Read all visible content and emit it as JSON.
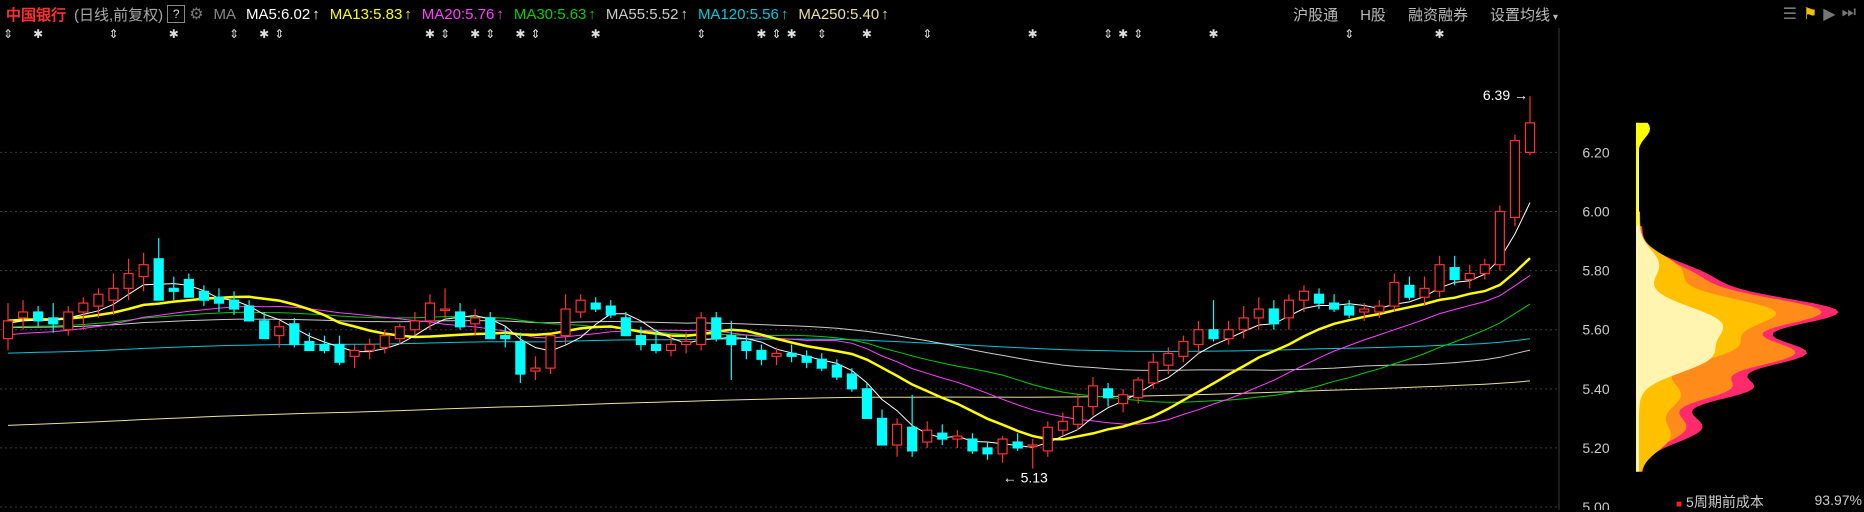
{
  "header": {
    "stock_name": "中国银行",
    "period": "(日线,前复权)",
    "help": "?",
    "ma_label": "MA",
    "ma_items": [
      {
        "label": "MA5:6.02",
        "color": "#ffffff",
        "arrow": "↑"
      },
      {
        "label": "MA13:5.83",
        "color": "#ffff00",
        "arrow": "↑"
      },
      {
        "label": "MA20:5.76",
        "color": "#ff40ff",
        "arrow": "↑"
      },
      {
        "label": "MA30:5.63",
        "color": "#00d000",
        "arrow": "↑"
      },
      {
        "label": "MA55:5.52",
        "color": "#cccccc",
        "arrow": "↑"
      },
      {
        "label": "MA120:5.56",
        "color": "#00c8d8",
        "arrow": "↑"
      },
      {
        "label": "MA250:5.40",
        "color": "#e8e0a0",
        "arrow": "↑"
      }
    ],
    "links": [
      "沪股通",
      "H股",
      "融资融券",
      "设置均线"
    ]
  },
  "colors": {
    "up": "#ff3030",
    "down": "#00ffff",
    "grid": "#3a3a3a",
    "axis_text": "#cccccc"
  },
  "chart_data": {
    "type": "candlestick",
    "y_ticks": [
      "6.20",
      "6.00",
      "5.80",
      "5.60",
      "5.40",
      "5.20",
      "5.00"
    ],
    "ylim": [
      4.99,
      6.56
    ],
    "annotations": {
      "high": "6.39 →",
      "low": "← 5.13"
    },
    "candles": [
      {
        "o": 5.57,
        "h": 5.69,
        "l": 5.53,
        "c": 5.63
      },
      {
        "o": 5.64,
        "h": 5.7,
        "l": 5.6,
        "c": 5.66
      },
      {
        "o": 5.66,
        "h": 5.68,
        "l": 5.61,
        "c": 5.63
      },
      {
        "o": 5.64,
        "h": 5.69,
        "l": 5.59,
        "c": 5.62
      },
      {
        "o": 5.6,
        "h": 5.68,
        "l": 5.58,
        "c": 5.66
      },
      {
        "o": 5.66,
        "h": 5.71,
        "l": 5.6,
        "c": 5.69
      },
      {
        "o": 5.68,
        "h": 5.74,
        "l": 5.64,
        "c": 5.72
      },
      {
        "o": 5.7,
        "h": 5.79,
        "l": 5.65,
        "c": 5.74
      },
      {
        "o": 5.74,
        "h": 5.84,
        "l": 5.7,
        "c": 5.79
      },
      {
        "o": 5.78,
        "h": 5.86,
        "l": 5.73,
        "c": 5.82
      },
      {
        "o": 5.84,
        "h": 5.91,
        "l": 5.7,
        "c": 5.7
      },
      {
        "o": 5.74,
        "h": 5.78,
        "l": 5.7,
        "c": 5.73
      },
      {
        "o": 5.77,
        "h": 5.79,
        "l": 5.71,
        "c": 5.71
      },
      {
        "o": 5.73,
        "h": 5.75,
        "l": 5.68,
        "c": 5.7
      },
      {
        "o": 5.71,
        "h": 5.74,
        "l": 5.66,
        "c": 5.69
      },
      {
        "o": 5.7,
        "h": 5.73,
        "l": 5.65,
        "c": 5.67
      },
      {
        "o": 5.68,
        "h": 5.7,
        "l": 5.64,
        "c": 5.63
      },
      {
        "o": 5.63,
        "h": 5.66,
        "l": 5.57,
        "c": 5.57
      },
      {
        "o": 5.58,
        "h": 5.63,
        "l": 5.54,
        "c": 5.61
      },
      {
        "o": 5.62,
        "h": 5.64,
        "l": 5.54,
        "c": 5.55
      },
      {
        "o": 5.56,
        "h": 5.59,
        "l": 5.53,
        "c": 5.53
      },
      {
        "o": 5.55,
        "h": 5.58,
        "l": 5.52,
        "c": 5.53
      },
      {
        "o": 5.55,
        "h": 5.58,
        "l": 5.48,
        "c": 5.49
      },
      {
        "o": 5.51,
        "h": 5.55,
        "l": 5.47,
        "c": 5.53
      },
      {
        "o": 5.53,
        "h": 5.57,
        "l": 5.5,
        "c": 5.55
      },
      {
        "o": 5.54,
        "h": 5.6,
        "l": 5.52,
        "c": 5.58
      },
      {
        "o": 5.57,
        "h": 5.62,
        "l": 5.55,
        "c": 5.61
      },
      {
        "o": 5.6,
        "h": 5.66,
        "l": 5.58,
        "c": 5.63
      },
      {
        "o": 5.63,
        "h": 5.72,
        "l": 5.6,
        "c": 5.69
      },
      {
        "o": 5.67,
        "h": 5.74,
        "l": 5.64,
        "c": 5.67
      },
      {
        "o": 5.66,
        "h": 5.69,
        "l": 5.6,
        "c": 5.61
      },
      {
        "o": 5.62,
        "h": 5.67,
        "l": 5.58,
        "c": 5.64
      },
      {
        "o": 5.64,
        "h": 5.66,
        "l": 5.57,
        "c": 5.57
      },
      {
        "o": 5.58,
        "h": 5.61,
        "l": 5.54,
        "c": 5.57
      },
      {
        "o": 5.56,
        "h": 5.59,
        "l": 5.42,
        "c": 5.45
      },
      {
        "o": 5.46,
        "h": 5.51,
        "l": 5.43,
        "c": 5.47
      },
      {
        "o": 5.47,
        "h": 5.58,
        "l": 5.45,
        "c": 5.58
      },
      {
        "o": 5.58,
        "h": 5.72,
        "l": 5.55,
        "c": 5.67
      },
      {
        "o": 5.66,
        "h": 5.72,
        "l": 5.64,
        "c": 5.7
      },
      {
        "o": 5.69,
        "h": 5.71,
        "l": 5.66,
        "c": 5.67
      },
      {
        "o": 5.68,
        "h": 5.7,
        "l": 5.64,
        "c": 5.65
      },
      {
        "o": 5.64,
        "h": 5.66,
        "l": 5.58,
        "c": 5.58
      },
      {
        "o": 5.58,
        "h": 5.61,
        "l": 5.53,
        "c": 5.55
      },
      {
        "o": 5.55,
        "h": 5.6,
        "l": 5.52,
        "c": 5.53
      },
      {
        "o": 5.53,
        "h": 5.58,
        "l": 5.51,
        "c": 5.55
      },
      {
        "o": 5.55,
        "h": 5.59,
        "l": 5.52,
        "c": 5.56
      },
      {
        "o": 5.55,
        "h": 5.66,
        "l": 5.53,
        "c": 5.64
      },
      {
        "o": 5.64,
        "h": 5.66,
        "l": 5.56,
        "c": 5.57
      },
      {
        "o": 5.58,
        "h": 5.63,
        "l": 5.43,
        "c": 5.55
      },
      {
        "o": 5.56,
        "h": 5.58,
        "l": 5.5,
        "c": 5.53
      },
      {
        "o": 5.53,
        "h": 5.55,
        "l": 5.48,
        "c": 5.5
      },
      {
        "o": 5.51,
        "h": 5.54,
        "l": 5.48,
        "c": 5.52
      },
      {
        "o": 5.52,
        "h": 5.55,
        "l": 5.49,
        "c": 5.51
      },
      {
        "o": 5.51,
        "h": 5.53,
        "l": 5.47,
        "c": 5.49
      },
      {
        "o": 5.5,
        "h": 5.52,
        "l": 5.46,
        "c": 5.47
      },
      {
        "o": 5.48,
        "h": 5.5,
        "l": 5.43,
        "c": 5.44
      },
      {
        "o": 5.45,
        "h": 5.47,
        "l": 5.39,
        "c": 5.4
      },
      {
        "o": 5.4,
        "h": 5.42,
        "l": 5.3,
        "c": 5.3
      },
      {
        "o": 5.3,
        "h": 5.33,
        "l": 5.21,
        "c": 5.21
      },
      {
        "o": 5.21,
        "h": 5.3,
        "l": 5.17,
        "c": 5.28
      },
      {
        "o": 5.27,
        "h": 5.38,
        "l": 5.17,
        "c": 5.19
      },
      {
        "o": 5.22,
        "h": 5.29,
        "l": 5.2,
        "c": 5.26
      },
      {
        "o": 5.25,
        "h": 5.28,
        "l": 5.21,
        "c": 5.23
      },
      {
        "o": 5.23,
        "h": 5.26,
        "l": 5.2,
        "c": 5.24
      },
      {
        "o": 5.23,
        "h": 5.25,
        "l": 5.18,
        "c": 5.19
      },
      {
        "o": 5.2,
        "h": 5.22,
        "l": 5.16,
        "c": 5.18
      },
      {
        "o": 5.18,
        "h": 5.24,
        "l": 5.15,
        "c": 5.23
      },
      {
        "o": 5.22,
        "h": 5.25,
        "l": 5.19,
        "c": 5.2
      },
      {
        "o": 5.21,
        "h": 5.23,
        "l": 5.13,
        "c": 5.21
      },
      {
        "o": 5.19,
        "h": 5.29,
        "l": 5.17,
        "c": 5.27
      },
      {
        "o": 5.26,
        "h": 5.32,
        "l": 5.24,
        "c": 5.29
      },
      {
        "o": 5.28,
        "h": 5.38,
        "l": 5.26,
        "c": 5.34
      },
      {
        "o": 5.34,
        "h": 5.44,
        "l": 5.31,
        "c": 5.41
      },
      {
        "o": 5.4,
        "h": 5.42,
        "l": 5.34,
        "c": 5.37
      },
      {
        "o": 5.35,
        "h": 5.4,
        "l": 5.32,
        "c": 5.38
      },
      {
        "o": 5.37,
        "h": 5.44,
        "l": 5.35,
        "c": 5.43
      },
      {
        "o": 5.42,
        "h": 5.52,
        "l": 5.4,
        "c": 5.49
      },
      {
        "o": 5.48,
        "h": 5.54,
        "l": 5.45,
        "c": 5.52
      },
      {
        "o": 5.51,
        "h": 5.58,
        "l": 5.49,
        "c": 5.56
      },
      {
        "o": 5.55,
        "h": 5.63,
        "l": 5.52,
        "c": 5.6
      },
      {
        "o": 5.6,
        "h": 5.7,
        "l": 5.56,
        "c": 5.57
      },
      {
        "o": 5.57,
        "h": 5.63,
        "l": 5.55,
        "c": 5.6
      },
      {
        "o": 5.6,
        "h": 5.68,
        "l": 5.57,
        "c": 5.64
      },
      {
        "o": 5.64,
        "h": 5.71,
        "l": 5.6,
        "c": 5.67
      },
      {
        "o": 5.67,
        "h": 5.7,
        "l": 5.6,
        "c": 5.62
      },
      {
        "o": 5.64,
        "h": 5.72,
        "l": 5.6,
        "c": 5.7
      },
      {
        "o": 5.7,
        "h": 5.75,
        "l": 5.66,
        "c": 5.73
      },
      {
        "o": 5.72,
        "h": 5.74,
        "l": 5.67,
        "c": 5.69
      },
      {
        "o": 5.69,
        "h": 5.72,
        "l": 5.66,
        "c": 5.67
      },
      {
        "o": 5.68,
        "h": 5.7,
        "l": 5.64,
        "c": 5.65
      },
      {
        "o": 5.66,
        "h": 5.69,
        "l": 5.63,
        "c": 5.67
      },
      {
        "o": 5.66,
        "h": 5.7,
        "l": 5.64,
        "c": 5.68
      },
      {
        "o": 5.68,
        "h": 5.79,
        "l": 5.66,
        "c": 5.76
      },
      {
        "o": 5.75,
        "h": 5.78,
        "l": 5.7,
        "c": 5.71
      },
      {
        "o": 5.71,
        "h": 5.78,
        "l": 5.68,
        "c": 5.74
      },
      {
        "o": 5.73,
        "h": 5.85,
        "l": 5.71,
        "c": 5.82
      },
      {
        "o": 5.81,
        "h": 5.85,
        "l": 5.75,
        "c": 5.77
      },
      {
        "o": 5.77,
        "h": 5.82,
        "l": 5.74,
        "c": 5.79
      },
      {
        "o": 5.79,
        "h": 5.84,
        "l": 5.77,
        "c": 5.82
      },
      {
        "o": 5.82,
        "h": 6.02,
        "l": 5.8,
        "c": 6.0
      },
      {
        "o": 5.98,
        "h": 6.26,
        "l": 5.95,
        "c": 6.24
      },
      {
        "o": 6.2,
        "h": 6.39,
        "l": 6.19,
        "c": 6.3
      }
    ]
  },
  "side_panel": {
    "footer_label": "5周期前成本",
    "footer_value": "93.97%"
  }
}
